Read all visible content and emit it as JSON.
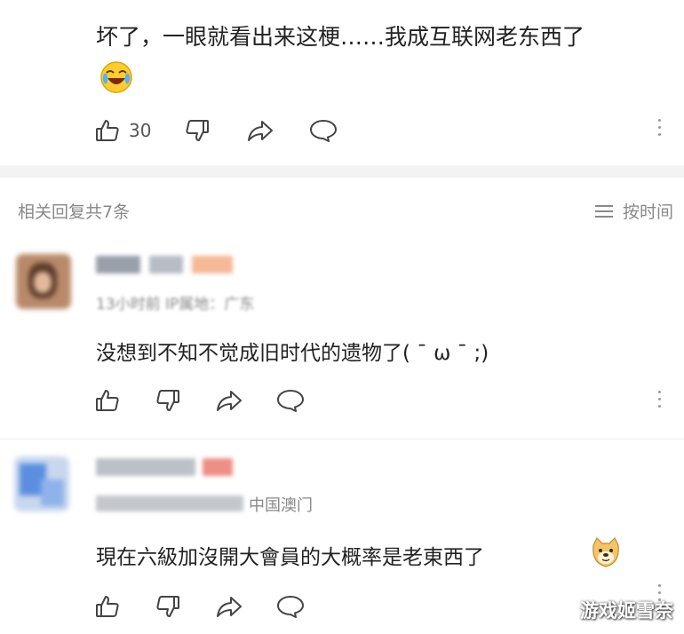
{
  "top_comment": {
    "text": "坏了，一眼就看出来这梗……我成互联网老东西了",
    "emoji": "crying-laugh-emoji",
    "like_count": "30"
  },
  "replies_header": {
    "title": "相关回复共7条",
    "sort_label": "按时间"
  },
  "replies": [
    {
      "meta": "13小时前 IP属地：广东",
      "text": "没想到不知不觉成旧时代的遗物了( ˉ ω ˉ ;)"
    },
    {
      "meta": "12小时前 · IP属地：中国澳门",
      "meta_visible": "中国澳门",
      "text": "現在六級加沒開大會員的大概率是老東西了",
      "emoji": "doge-emoji"
    }
  ],
  "watermark": "游戏姬雪奈",
  "colors": {
    "text": "#222222",
    "meta": "#888888",
    "icon": "#555555",
    "divider": "#f2f3f5"
  }
}
